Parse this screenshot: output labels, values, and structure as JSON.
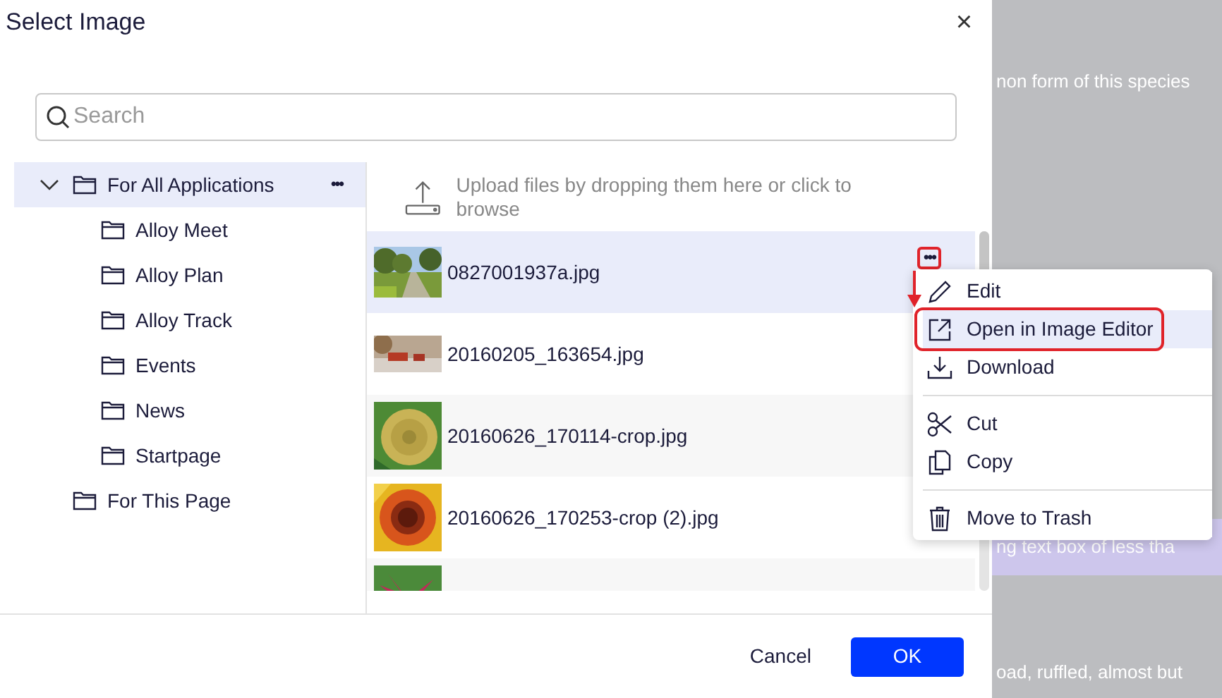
{
  "dialog": {
    "title": "Select Image",
    "close": "×"
  },
  "search": {
    "placeholder": "Search"
  },
  "tree": [
    {
      "label": "For All Applications",
      "expanded": true,
      "selected": true,
      "more": "•••",
      "children": [
        {
          "label": "Alloy Meet",
          "selected": false
        },
        {
          "label": "Alloy Plan",
          "selected": false
        },
        {
          "label": "Alloy Track",
          "selected": false
        },
        {
          "label": "Events",
          "selected": false
        },
        {
          "label": "News",
          "selected": false
        },
        {
          "label": "Startpage",
          "selected": false
        }
      ]
    },
    {
      "label": "For This Page",
      "selected": false
    }
  ],
  "upload": {
    "text": "Upload files by dropping them here or click to browse"
  },
  "files": [
    {
      "name": "0827001937a.jpg",
      "selected": true,
      "more": "•••",
      "annotated": true
    },
    {
      "name": "20160205_163654.jpg",
      "selected": false
    },
    {
      "name": "20160626_170114-crop.jpg",
      "selected": false
    },
    {
      "name": "20160626_170253-crop (2).jpg",
      "selected": false
    },
    {
      "selected": false
    }
  ],
  "menu": {
    "groups": [
      [
        {
          "kind": "edit",
          "label": "Edit",
          "selected": false,
          "annotated": false
        },
        {
          "kind": "open",
          "label": "Open in Image Editor",
          "selected": true,
          "annotated": true
        },
        {
          "kind": "download",
          "label": "Download",
          "selected": false,
          "annotated": false
        }
      ],
      [
        {
          "kind": "cut",
          "label": "Cut",
          "selected": false,
          "annotated": false
        },
        {
          "kind": "copy",
          "label": "Copy",
          "selected": false,
          "annotated": false
        }
      ],
      [
        {
          "kind": "trash",
          "label": "Move to Trash",
          "selected": false,
          "annotated": false
        }
      ]
    ]
  },
  "buttons": [
    {
      "kind": "secondary",
      "label": "Cancel"
    },
    {
      "kind": "primary",
      "label": "OK"
    }
  ],
  "background": {
    "texts": [
      {
        "text": "non form of this species",
        "highlighted": false
      },
      {
        "text": "ng text box of less tha",
        "highlighted": true
      },
      {
        "text": "oad, ruffled, almost but",
        "highlighted": false
      }
    ]
  }
}
